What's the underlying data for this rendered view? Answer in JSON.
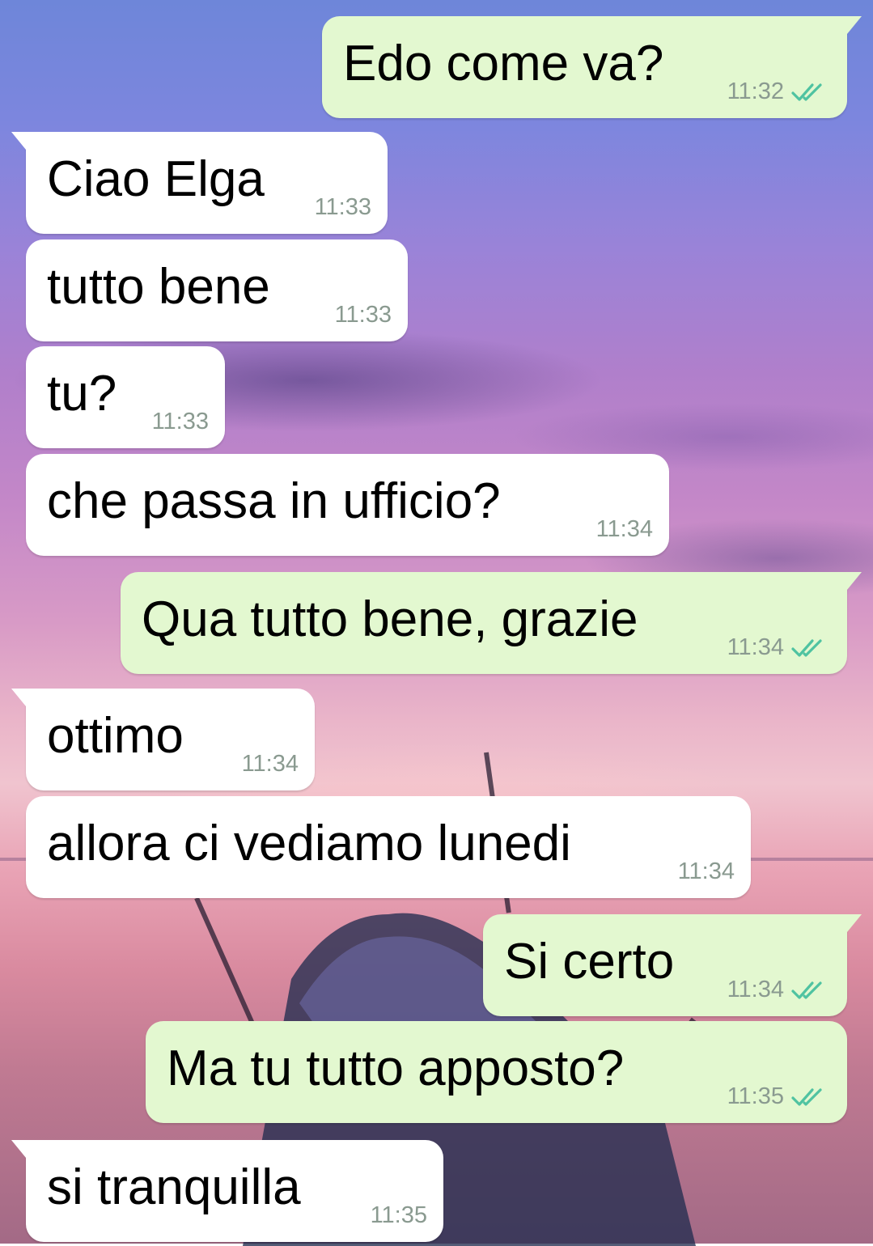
{
  "colors": {
    "incoming_bubble": "#ffffff",
    "outgoing_bubble": "#e3f8d0",
    "timestamp": "#8a9a90",
    "read_ticks": "#4fc3a1"
  },
  "messages": [
    {
      "direction": "out",
      "text": "Edo come va?",
      "time": "11:32",
      "status_icon": "double-check-icon"
    },
    {
      "direction": "in",
      "text": "Ciao Elga",
      "time": "11:33"
    },
    {
      "direction": "in",
      "text": "tutto bene",
      "time": "11:33"
    },
    {
      "direction": "in",
      "text": "tu?",
      "time": "11:33"
    },
    {
      "direction": "in",
      "text": "che passa in ufficio?",
      "time": "11:34"
    },
    {
      "direction": "out",
      "text": "Qua tutto bene, grazie",
      "time": "11:34",
      "status_icon": "double-check-icon"
    },
    {
      "direction": "in",
      "text": "ottimo",
      "time": "11:34"
    },
    {
      "direction": "in",
      "text": "allora ci vediamo lunedi",
      "time": "11:34"
    },
    {
      "direction": "out",
      "text": "Si certo",
      "time": "11:34",
      "status_icon": "double-check-icon"
    },
    {
      "direction": "out",
      "text": "Ma tu tutto apposto?",
      "time": "11:35",
      "status_icon": "double-check-icon"
    },
    {
      "direction": "in",
      "text": "si tranquilla",
      "time": "11:35"
    }
  ]
}
